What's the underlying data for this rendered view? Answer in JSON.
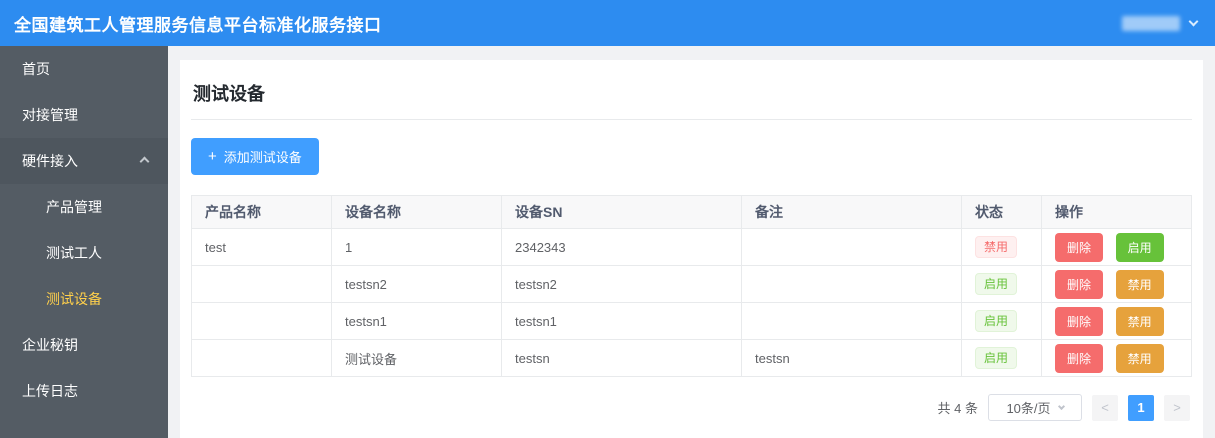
{
  "header": {
    "title": "全国建筑工人管理服务信息平台标准化服务接口",
    "user": {
      "name_redacted": true
    }
  },
  "sidebar": {
    "items": [
      {
        "label": "首页",
        "type": "item"
      },
      {
        "label": "对接管理",
        "type": "item"
      },
      {
        "label": "硬件接入",
        "type": "group",
        "expanded": true
      },
      {
        "label": "产品管理",
        "type": "subitem"
      },
      {
        "label": "测试工人",
        "type": "subitem"
      },
      {
        "label": "测试设备",
        "type": "subitem",
        "active": true
      },
      {
        "label": "企业秘钥",
        "type": "item"
      },
      {
        "label": "上传日志",
        "type": "item"
      }
    ]
  },
  "main": {
    "title": "测试设备",
    "add_button": {
      "icon": "+",
      "label": "添加测试设备"
    }
  },
  "table": {
    "columns": [
      "产品名称",
      "设备名称",
      "设备SN",
      "备注",
      "状态",
      "操作"
    ],
    "rows": [
      {
        "product": "test",
        "device": "1",
        "sn": "2342343",
        "remark": "",
        "status": {
          "label": "禁用",
          "state": "disabled"
        },
        "actions": [
          {
            "label": "删除",
            "type": "danger"
          },
          {
            "label": "启用",
            "type": "success"
          }
        ]
      },
      {
        "product": "",
        "device": "testsn2",
        "sn": "testsn2",
        "remark": "",
        "status": {
          "label": "启用",
          "state": "enabled"
        },
        "actions": [
          {
            "label": "删除",
            "type": "danger"
          },
          {
            "label": "禁用",
            "type": "warning"
          }
        ]
      },
      {
        "product": "",
        "device": "testsn1",
        "sn": "testsn1",
        "remark": "",
        "status": {
          "label": "启用",
          "state": "enabled"
        },
        "actions": [
          {
            "label": "删除",
            "type": "danger"
          },
          {
            "label": "禁用",
            "type": "warning"
          }
        ]
      },
      {
        "product": "",
        "device": "测试设备",
        "sn": "testsn",
        "remark": "testsn",
        "status": {
          "label": "启用",
          "state": "enabled"
        },
        "actions": [
          {
            "label": "删除",
            "type": "danger"
          },
          {
            "label": "禁用",
            "type": "warning"
          }
        ]
      }
    ]
  },
  "pagination": {
    "total_text": "共 4 条",
    "page_size_selected": "10条/页",
    "prev_icon": "<",
    "current_page": "1",
    "next_icon": ">"
  },
  "theme": {
    "header_blue": "#2d8cf0",
    "sidebar_bg": "#545c64",
    "sidebar_active_text": "#ffd04b",
    "primary": "#409eff",
    "danger": "#f56c6c",
    "success": "#67c23a",
    "warning": "#e6a23c",
    "tag_danger_bg": "#fef0f0",
    "tag_success_bg": "#f0f9eb"
  }
}
